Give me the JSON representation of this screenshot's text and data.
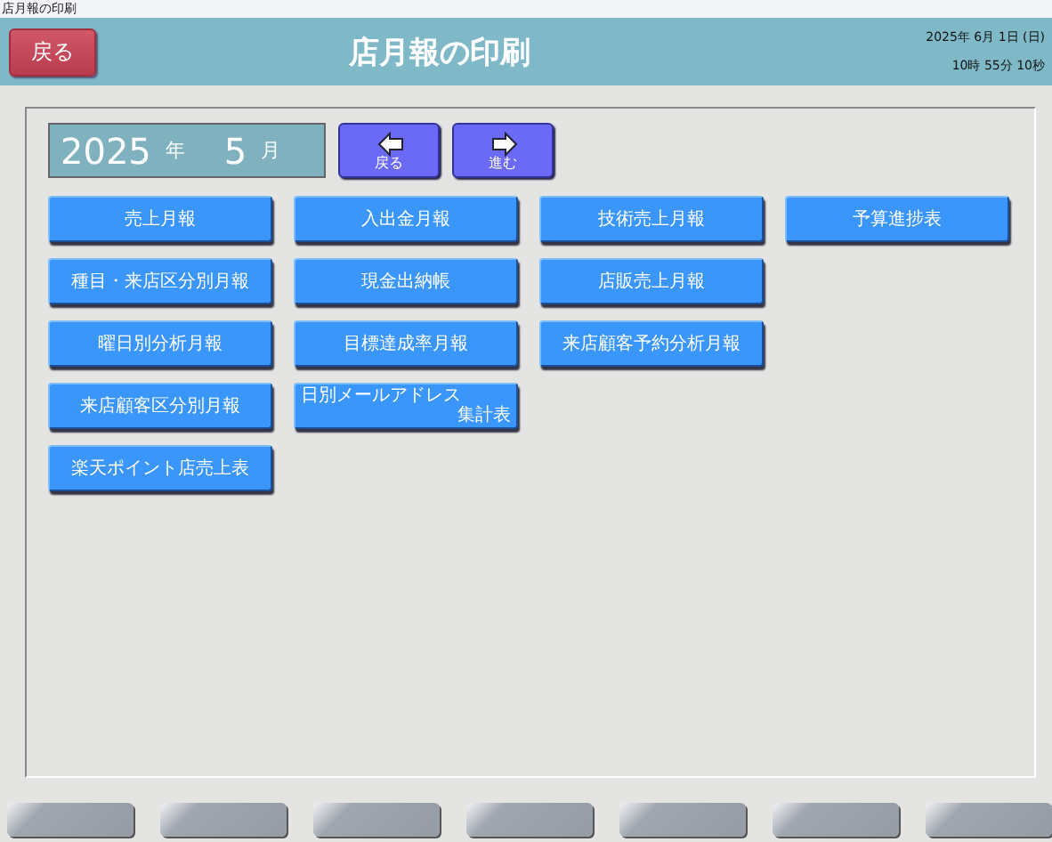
{
  "window": {
    "title": "店月報の印刷"
  },
  "header": {
    "back_button": "戻る",
    "title": "店月報の印刷",
    "date": "2025年 6月 1日 (日)",
    "time": "10時 55分 10秒"
  },
  "period": {
    "year": "2025",
    "year_unit": "年",
    "month": "5",
    "month_unit": "月"
  },
  "nav_buttons": [
    {
      "kind": "prev",
      "label": "戻る"
    },
    {
      "kind": "next",
      "label": "進む"
    }
  ],
  "report_rows": [
    [
      {
        "lines": [
          "売上月報"
        ]
      },
      {
        "lines": [
          "入出金月報"
        ]
      },
      {
        "lines": [
          "技術売上月報"
        ]
      },
      {
        "lines": [
          "予算進捗表"
        ]
      }
    ],
    [
      {
        "lines": [
          "種目・来店区分別月報"
        ]
      },
      {
        "lines": [
          "現金出納帳"
        ]
      },
      {
        "lines": [
          "店販売上月報"
        ]
      }
    ],
    [
      {
        "lines": [
          "曜日別分析月報"
        ]
      },
      {
        "lines": [
          "目標達成率月報"
        ]
      },
      {
        "lines": [
          "来店顧客予約分析月報"
        ]
      }
    ],
    [
      {
        "lines": [
          "来店顧客区分別月報"
        ]
      },
      {
        "lines": [
          "日別メールアドレス",
          "集計表"
        ]
      }
    ],
    [
      {
        "lines": [
          "楽天ポイント店売上表"
        ]
      }
    ]
  ]
}
